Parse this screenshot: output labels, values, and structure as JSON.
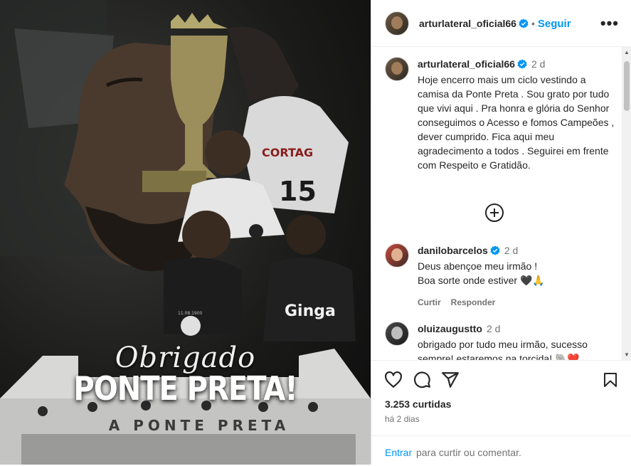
{
  "media": {
    "title_script": "Obrigado",
    "title_main": "PONTE PRETA!",
    "facade_text": "A PONTE PRETA",
    "jersey_sponsor_1": "CORTAG",
    "jersey_number": "15",
    "jersey_sponsor_2": "Ginga",
    "crest_date": "11.08.1900"
  },
  "header": {
    "username": "arturlateral_oficial66",
    "separator": "•",
    "follow_label": "Seguir",
    "more_label": "•••"
  },
  "caption": {
    "username": "arturlateral_oficial66",
    "time": "2 d",
    "text": "Hoje encerro mais um ciclo vestindo a camisa da Ponte Preta . Sou grato por tudo que vivi aqui . Pra honra e glória do Senhor conseguimos o Acesso e fomos Campeões , dever cumprido. Fica aqui meu agradecimento a todos . Seguirei em frente com Respeito e Gratidão."
  },
  "comments": [
    {
      "username": "danilobarcelos",
      "time": "2 d",
      "text": "Deus abençoe meu irmão !\nBoa sorte onde estiver 🖤🙏",
      "like_label": "Curtir",
      "reply_label": "Responder"
    },
    {
      "username": "oluizaugustto",
      "time": "2 d",
      "text": "obrigado por tudo meu irmão, sucesso sempre! estaremos na torcida! 🐘❤️"
    }
  ],
  "footer": {
    "likes": "3.253 curtidas",
    "date": "há 2 dias",
    "login_link": "Entrar",
    "login_rest": "para curtir ou comentar."
  },
  "icons": [
    "heart-icon",
    "comment-icon",
    "share-icon",
    "bookmark-icon",
    "plus-circle-icon",
    "verified-icon"
  ],
  "colors": {
    "accent": "#0095f6",
    "text": "#262626",
    "muted": "#737373"
  }
}
